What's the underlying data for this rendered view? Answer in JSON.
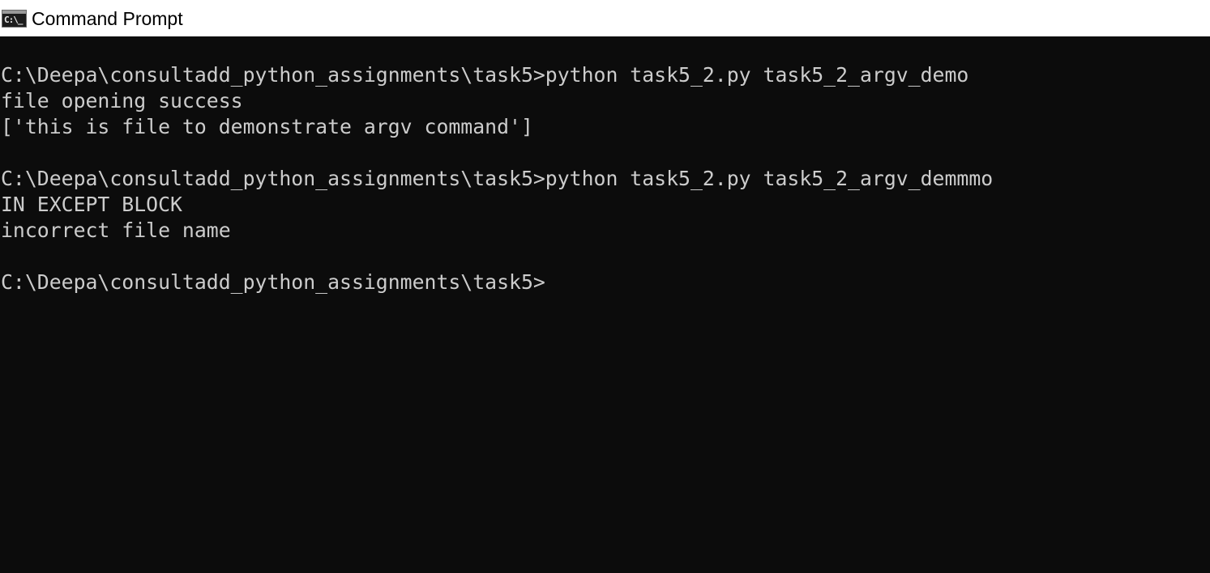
{
  "window": {
    "title": "Command Prompt",
    "icon": "cmd-app-icon",
    "icon_text": "C:\\_"
  },
  "console": {
    "lines": [
      "",
      "C:\\Deepa\\consultadd_python_assignments\\task5>python task5_2.py task5_2_argv_demo",
      "file opening success",
      "['this is file to demonstrate argv command']",
      "",
      "C:\\Deepa\\consultadd_python_assignments\\task5>python task5_2.py task5_2_argv_demmmo",
      "IN EXCEPT BLOCK",
      "incorrect file name",
      "",
      "C:\\Deepa\\consultadd_python_assignments\\task5>"
    ]
  },
  "colors": {
    "console_background": "#0c0c0c",
    "console_text": "#cccccc",
    "titlebar_background": "#ffffff"
  }
}
